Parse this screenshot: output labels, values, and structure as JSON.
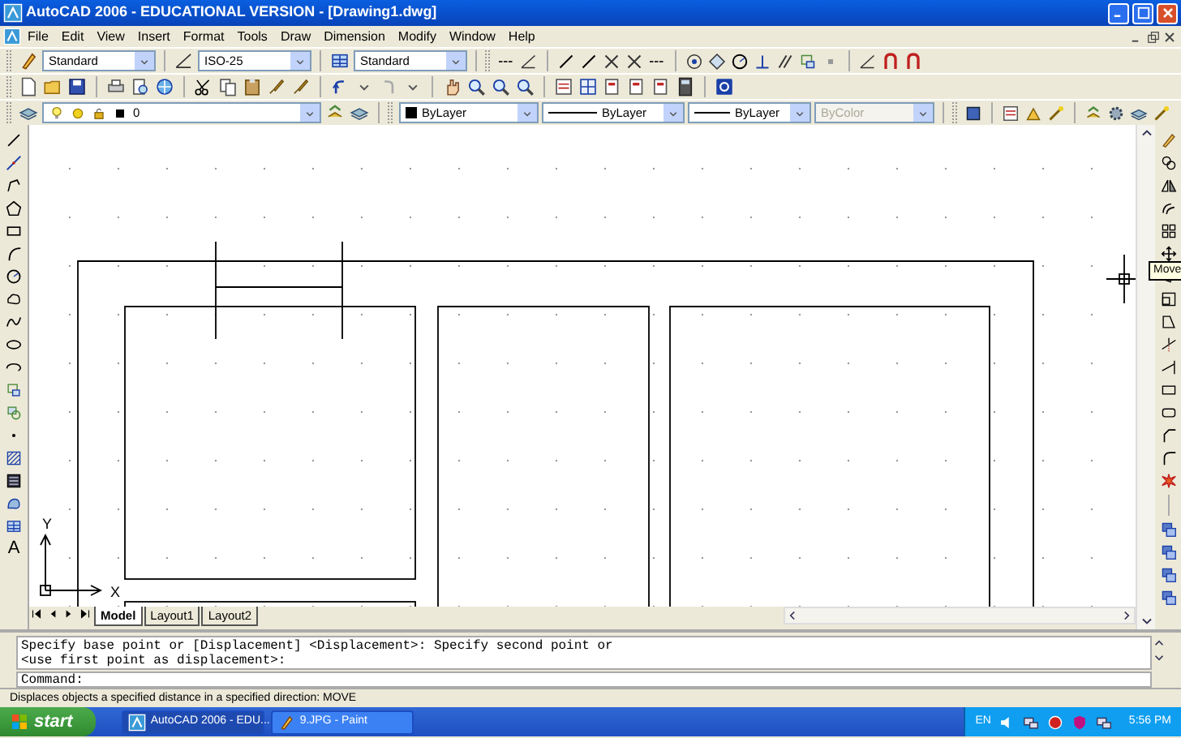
{
  "window": {
    "title": "AutoCAD 2006 - EDUCATIONAL VERSION - [Drawing1.dwg]"
  },
  "menu": [
    "File",
    "Edit",
    "View",
    "Insert",
    "Format",
    "Tools",
    "Draw",
    "Dimension",
    "Modify",
    "Window",
    "Help"
  ],
  "styles_toolbar": {
    "text_style": "Standard",
    "dim_style": "ISO-25",
    "table_style": "Standard"
  },
  "layers_toolbar": {
    "layer": "0"
  },
  "properties_toolbar": {
    "color_setting": "ByLayer",
    "linetype": "ByLayer",
    "lineweight": "ByLayer",
    "plot_style": "ByColor",
    "plot_style_disabled": true
  },
  "draw_toolbar": {
    "text_tool": "A"
  },
  "canvas": {
    "ucs_y": "Y",
    "ucs_x": "X",
    "tooltip": "Move"
  },
  "layout_tabs": [
    {
      "label": "Model",
      "selected": true
    },
    {
      "label": "Layout1",
      "selected": false
    },
    {
      "label": "Layout2",
      "selected": false
    }
  ],
  "command_window": {
    "history": [
      "Specify base point or [Displacement] <Displacement>: Specify second point or",
      "<use first point as displacement>:"
    ],
    "prompt": "Command:"
  },
  "status_bar": "Displaces objects a specified distance in a specified direction:  MOVE",
  "taskbar": {
    "start": "start",
    "tasks": [
      {
        "label": "AutoCAD 2006 - EDU...",
        "selected": true
      },
      {
        "label": "9.JPG - Paint",
        "selected": false
      }
    ],
    "language": "EN",
    "clock": "5:56 PM"
  }
}
